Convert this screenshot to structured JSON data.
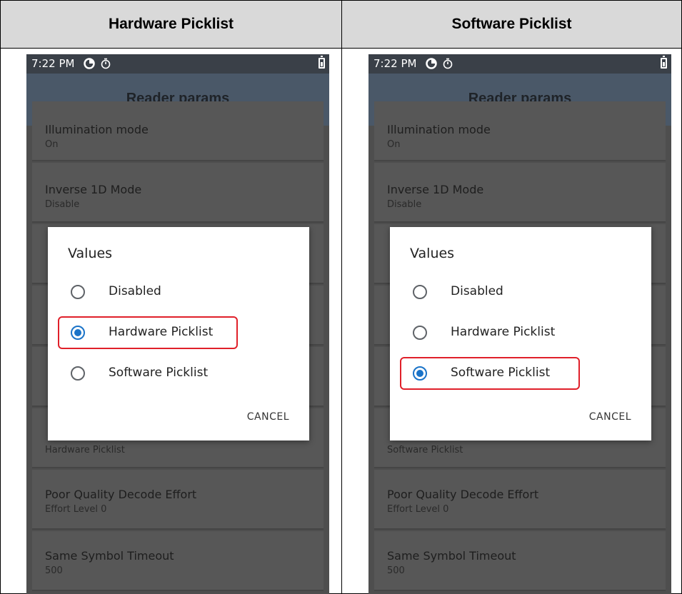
{
  "table": {
    "headers": [
      "Hardware Picklist",
      "Software Picklist"
    ]
  },
  "panels": [
    {
      "status_bar": {
        "time": "7:22 PM",
        "icons": [
          "data-saver-icon",
          "timer-icon",
          "battery-charging-icon"
        ]
      },
      "app_bar": {
        "title": "Reader params"
      },
      "list": [
        {
          "title": "Illumination mode",
          "subtitle": "On"
        },
        {
          "title": "Inverse 1D Mode",
          "subtitle": "Disable"
        },
        {
          "title": "",
          "subtitle": ""
        },
        {
          "title": "",
          "subtitle": ""
        },
        {
          "title": "",
          "subtitle": ""
        },
        {
          "title": "",
          "subtitle": "Hardware Picklist"
        },
        {
          "title": "Poor Quality Decode Effort",
          "subtitle": "Effort Level 0"
        },
        {
          "title": "Same Symbol Timeout",
          "subtitle": "500"
        }
      ],
      "dialog": {
        "title": "Values",
        "options": [
          {
            "label": "Disabled",
            "selected": false
          },
          {
            "label": "Hardware Picklist",
            "selected": true
          },
          {
            "label": "Software Picklist",
            "selected": false
          }
        ],
        "cancel_label": "CANCEL"
      }
    },
    {
      "status_bar": {
        "time": "7:22 PM",
        "icons": [
          "data-saver-icon",
          "timer-icon",
          "battery-charging-icon"
        ]
      },
      "app_bar": {
        "title": "Reader params"
      },
      "list": [
        {
          "title": "Illumination mode",
          "subtitle": "On"
        },
        {
          "title": "Inverse 1D Mode",
          "subtitle": "Disable"
        },
        {
          "title": "",
          "subtitle": ""
        },
        {
          "title": "",
          "subtitle": ""
        },
        {
          "title": "",
          "subtitle": ""
        },
        {
          "title": "",
          "subtitle": "Software Picklist"
        },
        {
          "title": "Poor Quality Decode Effort",
          "subtitle": "Effort Level 0"
        },
        {
          "title": "Same Symbol Timeout",
          "subtitle": "500"
        }
      ],
      "dialog": {
        "title": "Values",
        "options": [
          {
            "label": "Disabled",
            "selected": false
          },
          {
            "label": "Hardware Picklist",
            "selected": false
          },
          {
            "label": "Software Picklist",
            "selected": true
          }
        ],
        "cancel_label": "CANCEL"
      }
    }
  ],
  "colors": {
    "selection_outline": "#e0202a",
    "radio_selected": "#1a73c8",
    "app_bar": "#4a5868",
    "status_bar": "#3a4048"
  }
}
